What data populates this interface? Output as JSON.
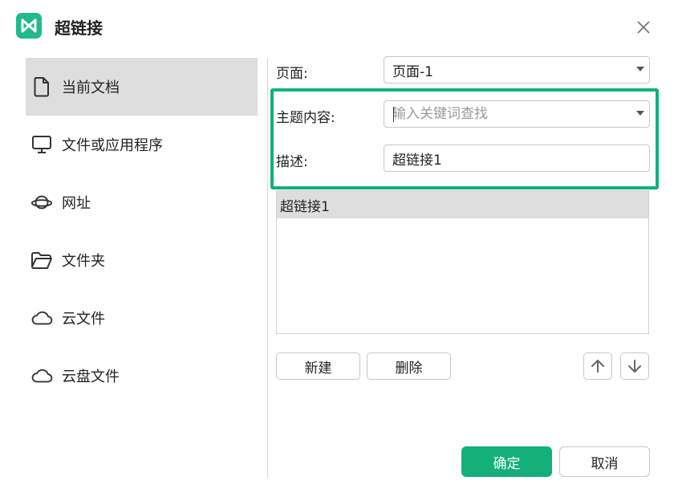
{
  "dialog": {
    "title": "超链接"
  },
  "colors": {
    "accent": "#13b07a",
    "logo": "#22b98b"
  },
  "sidebar": {
    "items": [
      {
        "label": "当前文档",
        "icon": "document-icon",
        "active": true
      },
      {
        "label": "文件或应用程序",
        "icon": "monitor-icon",
        "active": false
      },
      {
        "label": "网址",
        "icon": "planet-icon",
        "active": false
      },
      {
        "label": "文件夹",
        "icon": "folder-icon",
        "active": false
      },
      {
        "label": "云文件",
        "icon": "cloud-icon",
        "active": false
      },
      {
        "label": "云盘文件",
        "icon": "cloud-icon",
        "active": false
      }
    ]
  },
  "form": {
    "page_label": "页面:",
    "page_value": "页面-1",
    "topic_label": "主题内容:",
    "topic_placeholder": "输入关键词查找",
    "desc_label": "描述:",
    "desc_value": "超链接1"
  },
  "list": {
    "items": [
      "超链接1"
    ]
  },
  "buttons": {
    "new": "新建",
    "delete": "删除",
    "ok": "确定",
    "cancel": "取消"
  }
}
